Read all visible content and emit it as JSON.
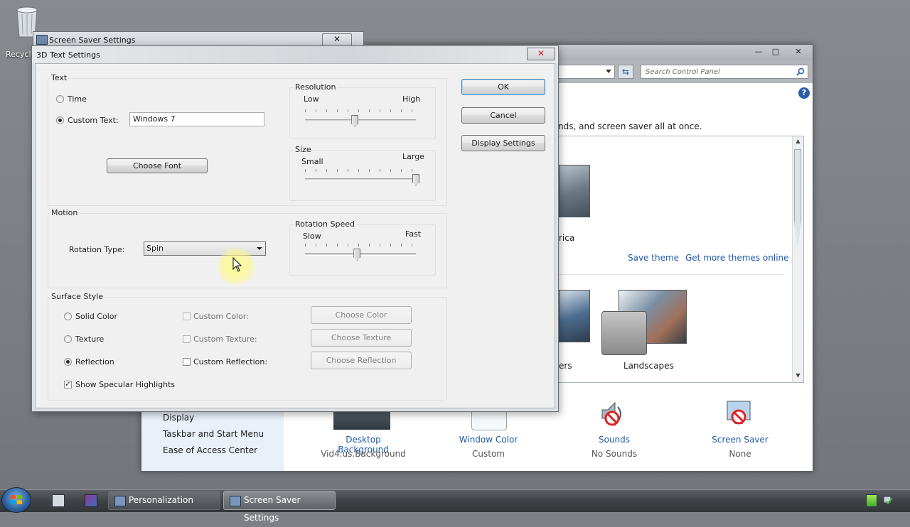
{
  "desktop": {
    "recycle_bin_label": "Recycle Bin"
  },
  "personalization": {
    "search_placeholder": "Search Control Panel",
    "intro_text": "nds, and screen saver all at once.",
    "theme_fragment_1": "rica",
    "save_theme": "Save theme",
    "get_more_themes": "Get more themes online",
    "theme_fragment_2": "ers",
    "theme_landscapes": "Landscapes",
    "sidebar_links": [
      "Display",
      "Taskbar and Start Menu",
      "Ease of Access Center"
    ],
    "bottom_items": [
      {
        "title": "Desktop Background",
        "value": "Vid4.us.Background"
      },
      {
        "title": "Window Color",
        "value": "Custom"
      },
      {
        "title": "Sounds",
        "value": "No Sounds"
      },
      {
        "title": "Screen Saver",
        "value": "None"
      }
    ],
    "link_color": "#1f5aa6"
  },
  "screen_saver_settings": {
    "title": "Screen Saver Settings"
  },
  "dialog": {
    "title": "3D Text Settings",
    "text_group": {
      "title": "Text",
      "time_label": "Time",
      "custom_text_label": "Custom Text:",
      "custom_text_value": "Windows 7",
      "choose_font": "Choose Font",
      "selected": "custom"
    },
    "resolution": {
      "title": "Resolution",
      "min_label": "Low",
      "max_label": "High",
      "value": 0.45
    },
    "size": {
      "title": "Size",
      "min_label": "Small",
      "max_label": "Large",
      "value": 1.0
    },
    "motion_group": {
      "title": "Motion",
      "rotation_type_label": "Rotation Type:",
      "rotation_type_value": "Spin"
    },
    "rotation_speed": {
      "title": "Rotation Speed",
      "min_label": "Slow",
      "max_label": "Fast",
      "value": 0.47
    },
    "surface_group": {
      "title": "Surface Style",
      "solid_color": "Solid Color",
      "texture": "Texture",
      "reflection": "Reflection",
      "selected": "reflection",
      "custom_color": "Custom Color:",
      "custom_texture": "Custom Texture:",
      "custom_reflection": "Custom Reflection:",
      "choose_color": "Choose Color",
      "choose_texture": "Choose Texture",
      "choose_reflection": "Choose Reflection",
      "specular": "Show Specular Highlights",
      "specular_checked": true
    },
    "buttons": {
      "ok": "OK",
      "cancel": "Cancel",
      "display_settings": "Display Settings"
    }
  },
  "taskbar": {
    "tasks": [
      "Personalization",
      "Screen Saver Settings"
    ],
    "active_task": "Screen Saver Settings"
  }
}
